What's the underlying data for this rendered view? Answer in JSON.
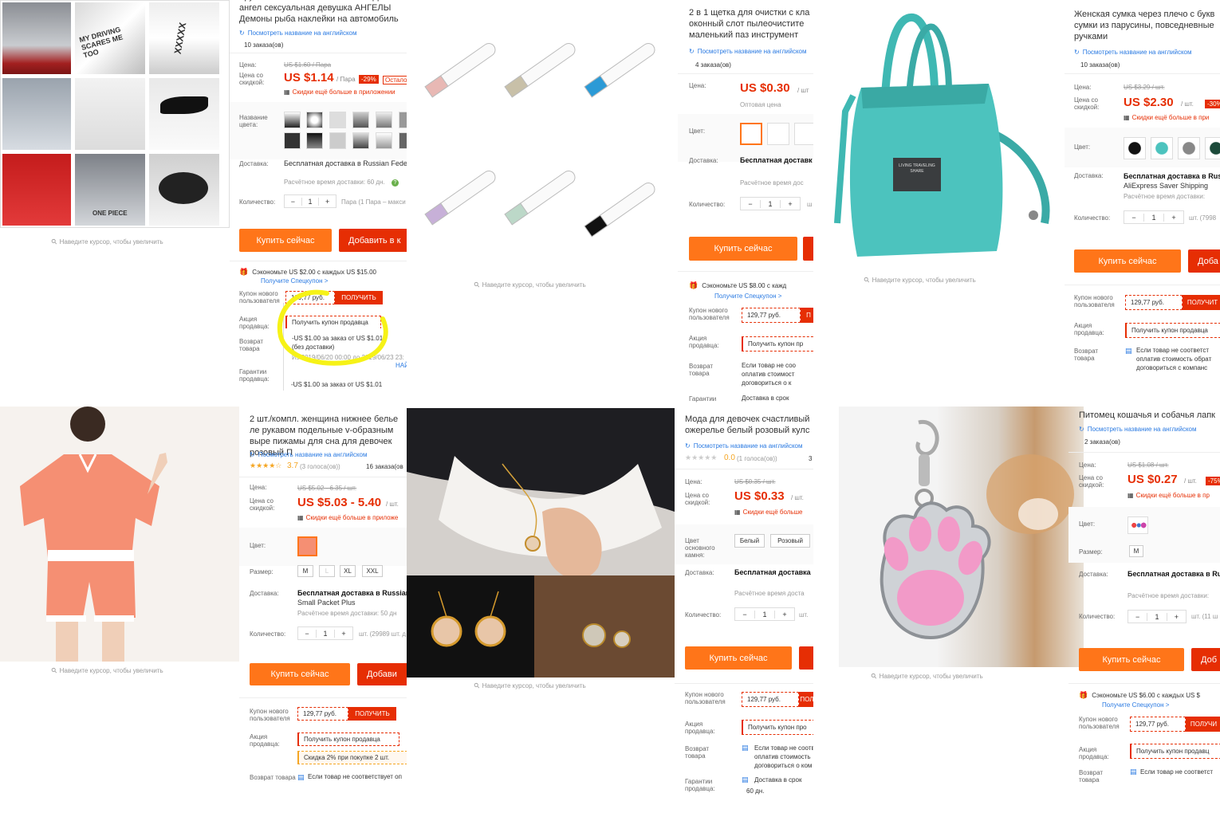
{
  "common": {
    "zoom_hint": "Наведите курсор, чтобы увеличить",
    "english_link": "Посмотреть название на английском",
    "label_price": "Цена:",
    "label_discount_price": "Цена со скидкой:",
    "label_color": "Цвет:",
    "label_delivery": "Доставка:",
    "label_quantity": "Количество:",
    "label_size": "Размер:",
    "label_new_user_coupon": "Купон нового пользователя",
    "label_seller_promo": "Акция продавца:",
    "label_return": "Возврат товара",
    "label_guarantee": "Гарантии продавца:",
    "buy_now": "Купить сейчас",
    "add_to_cart": "Добавить в к",
    "coupon_value": "129,77 руб.",
    "get_button": "ПОЛУЧИТЬ",
    "get_seller_coupon": "Получить купон продавца",
    "app_discount": "Скидки ещё больше в приложении",
    "free_delivery": "Бесплатная доставка в Russian Federa",
    "special_coupon_link": "Получите Спецкупон >",
    "return_text": "Если товар не соответствует описанию, верните его полностью",
    "qty_one": "1"
  },
  "p1": {
    "title": "Крутая наклейка на автомобиль Дизайн ангел сексуальная девушка АНГЕЛЫ Демоны рыба наклейки на автомобиль",
    "orders": "10 заказа(ов)",
    "old_price": "US $1.60 / Пара",
    "price": "US $1.14",
    "unit": "/ Пара",
    "discount": "-29%",
    "left": "Остало",
    "color_label": "Название цвета:",
    "delivery_time": "Расчётное время доставки: 60 дн.",
    "qty_note": "Пара (1 Пара – макси",
    "save_text": "Сэкономьте US $2.00 с каждых US $15.00",
    "promo_line1": "-US $1.00 за заказ от US $1.01",
    "promo_line2": "(без доставки)",
    "promo_dates": "Из 2019/06/20 00:00 до 2019/06/23 23:",
    "promo_more": "НАЙ",
    "promo_line3": "-US $1.00 за заказ от US $1.01",
    "sticker_texts": [
      "MY DRIVING SCARES ME TOO",
      "XXXXX",
      "ONE PIECE"
    ]
  },
  "p2": {
    "title": "2 в 1 щетка для очистки с кла оконный слот пылеочистите маленький паз инструмент",
    "orders": "4 заказа(ов)",
    "price": "US $0.30",
    "unit": "/ шт",
    "wholesale": "Оптовая цена",
    "delivery": "Бесплатная доставк",
    "delivery_time": "Расчётное время дос",
    "qty_unit": "ш",
    "save_text": "Сэкономьте US $8.00 с кажд",
    "seller_btn": "Получить купон пр",
    "return_text": "Если товар не соо оплатив стоимост договориться о к",
    "guarantee": "Гарантии",
    "on_time": "Доставка в срок"
  },
  "p3": {
    "title": "Женская сумка через плечо с букв сумки из парусины, повседневные ручками",
    "orders": "10 заказа(ов)",
    "old_price": "US $3.29 / шт.",
    "price": "US $2.30",
    "unit": "/ шт.",
    "discount": "-30%",
    "app": "Скидки ещё больше в при",
    "delivery": "Бесплатная доставка в Rus",
    "delivery2": "AliExpress Saver Shipping",
    "delivery_time": "Расчётное время доставки:",
    "qty_note": "шт. (7998",
    "buy": "Купить сейчас",
    "add": "Доба",
    "get": "ПОЛУЧИТ",
    "seller_btn": "Получить купон продавца",
    "return_text": "Если товар не соответст оплатив стоимость обрат договориться с компанс",
    "bag_label": "LIVING TRAVELING SHARE"
  },
  "p4": {
    "title": "2 шт./компл. женщина нижнее белье ле рукавом подельные v-образным выре пижамы для сна для девочек розовый П",
    "rating": "3.7",
    "votes": "(3 голоса(ов))",
    "orders": "16 заказа(ов",
    "old_price": "US $5.02 - 6.35 / шт.",
    "price": "US $5.03 - 5.40",
    "unit": "/ шт.",
    "app": "Скидки ещё больше в приложе",
    "sizes": [
      "M",
      "L",
      "XL",
      "XXL"
    ],
    "delivery": "Бесплатная доставка в Russian F",
    "delivery2": "Small Packet Plus",
    "delivery_time": "Расчётное время доставки: 50 дн",
    "qty_note": "шт. (29989 шт. д",
    "add": "Добави",
    "promo2": "Скидка 2% при покупке 2 шт.",
    "return_text": "Если товар не соответствует оп"
  },
  "p5": {
    "title": "Мода для девочек счастливый ожерелье белый розовый кулс",
    "rating": "0.0",
    "votes": "(1 голоса(ов))",
    "orders": "3",
    "old_price": "US $0.35 / шт.",
    "price": "US $0.33",
    "unit": "/ шт.",
    "app": "Скидки ещё больше",
    "stone_label": "Цвет основного камня:",
    "stone_options": [
      "Белый",
      "Розовый"
    ],
    "delivery": "Бесплатная доставка",
    "delivery_time": "Расчётное время доста",
    "qty_unit": "шт.",
    "get": "ПОЛ",
    "seller_btn": "Получить купон про",
    "return_text": "Если товар не соотв оплатив стоимость договориться о ком",
    "on_time": "Доставка в срок",
    "days": "60 дн."
  },
  "p6": {
    "title": "Питомец кошачья и собачья лапк",
    "orders": "2 заказа(ов)",
    "old_price": "US $1.08 / шт.",
    "price": "US $0.27",
    "unit": "/ шт.",
    "discount": "-75%",
    "app": "Скидки ещё больше в пр",
    "size": "M",
    "delivery": "Бесплатная доставка в Ru",
    "delivery_time": "Расчётное время доставки:",
    "qty_note": "шт. (11 ш",
    "add": "Доб",
    "save_text": "Сэкономьте US $6.00 с каждых US $",
    "get": "ПОЛУЧИ",
    "seller_btn": "Получить купон продавц",
    "return_text": "Если товар не соответст"
  }
}
